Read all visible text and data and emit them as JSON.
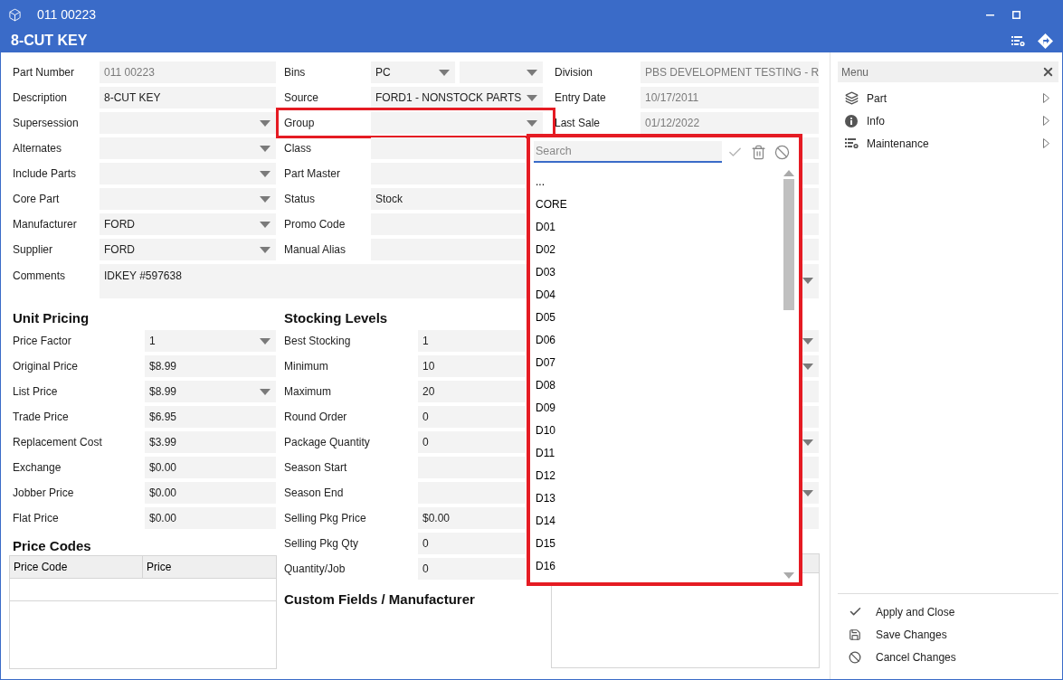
{
  "window": {
    "title": "011 00223",
    "heading": "8-CUT KEY"
  },
  "general": {
    "column_1": [
      {
        "label": "Part Number",
        "fields": [
          {
            "value": "011 00223",
            "readonly": true,
            "dropdown": false
          }
        ]
      },
      {
        "label": "Description",
        "fields": [
          {
            "value": "8-CUT KEY",
            "readonly": false,
            "dropdown": false
          }
        ]
      },
      {
        "label": "Supersession",
        "fields": [
          {
            "dropdown": true
          }
        ]
      },
      {
        "label": "Alternates",
        "fields": [
          {
            "dropdown": true
          }
        ]
      },
      {
        "label": "Include Parts",
        "fields": [
          {
            "dropdown": true
          }
        ]
      },
      {
        "label": "Core Part",
        "fields": [
          {
            "dropdown": true
          }
        ]
      },
      {
        "label": "Manufacturer",
        "fields": [
          {
            "value": "FORD",
            "readonly": false,
            "dropdown": true
          }
        ]
      },
      {
        "label": "Supplier",
        "fields": [
          {
            "value": "FORD",
            "readonly": false,
            "dropdown": true
          }
        ]
      }
    ],
    "column_2": [
      {
        "label": "Bins",
        "highlighted": false,
        "fields": [
          {
            "value": "PC",
            "readonly": false,
            "dropdown": true
          },
          {
            "dropdown": true
          }
        ]
      },
      {
        "label": "Source",
        "highlighted": false,
        "fields": [
          {
            "value": "FORD1 - NONSTOCK PARTS",
            "readonly": false,
            "dropdown": true
          }
        ]
      },
      {
        "label": "Group",
        "highlighted": true,
        "fields": [
          {
            "dropdown": true
          }
        ]
      },
      {
        "label": "Class",
        "highlighted": false,
        "fields": [
          {
            "dropdown": false
          }
        ]
      },
      {
        "label": "Part Master",
        "highlighted": false,
        "fields": [
          {
            "dropdown": false
          }
        ]
      },
      {
        "label": "Status",
        "highlighted": false,
        "fields": [
          {
            "value": "Stock",
            "readonly": false,
            "dropdown": false
          }
        ]
      },
      {
        "label": "Promo Code",
        "highlighted": false,
        "fields": [
          {
            "dropdown": false
          }
        ]
      },
      {
        "label": "Manual Alias",
        "highlighted": false,
        "fields": [
          {
            "dropdown": false
          }
        ]
      }
    ],
    "column_3": [
      {
        "label": "Division",
        "fields": [
          {
            "value": "PBS DEVELOPMENT TESTING - R",
            "readonly": true
          }
        ]
      },
      {
        "label": "Entry Date",
        "fields": [
          {
            "value": "10/17/2011",
            "readonly": true,
            "dropdown": false
          }
        ]
      },
      {
        "label": "Last Sale",
        "fields": [
          {
            "value": "01/12/2022",
            "readonly": true,
            "dropdown": false
          }
        ]
      },
      {
        "fields": [
          {
            "dropdown": false
          }
        ]
      },
      {
        "fields": [
          {
            "dropdown": false
          }
        ]
      },
      {
        "fields": [
          {
            "dropdown": false
          }
        ]
      },
      {
        "fields": [
          {
            "dropdown": false
          }
        ]
      },
      {
        "fields": [
          {
            "dropdown": false
          }
        ]
      }
    ],
    "comments": {
      "label": "Comments",
      "value": "IDKEY #597638",
      "dropdown": true
    }
  },
  "unit_pricing": {
    "title": "Unit Pricing",
    "rows": [
      {
        "label": "Price Factor",
        "value": "1",
        "dropdown": true
      },
      {
        "label": "Original Price",
        "value": "$8.99",
        "dropdown": false
      },
      {
        "label": "List Price",
        "value": "$8.99",
        "dropdown": true
      },
      {
        "label": "Trade Price",
        "value": "$6.95",
        "dropdown": false
      },
      {
        "label": "Replacement Cost",
        "value": "$3.99",
        "dropdown": false
      },
      {
        "label": "Exchange",
        "value": "$0.00",
        "dropdown": false
      },
      {
        "label": "Jobber Price",
        "value": "$0.00",
        "dropdown": false
      },
      {
        "label": "Flat Price",
        "value": "$0.00",
        "dropdown": false
      }
    ]
  },
  "price_codes": {
    "title": "Price Codes",
    "columns": [
      "Price Code",
      "Price"
    ]
  },
  "stocking_levels": {
    "title": "Stocking Levels",
    "rows": [
      {
        "label": "Best Stocking",
        "value": "1"
      },
      {
        "label": "Minimum",
        "value": "10"
      },
      {
        "label": "Maximum",
        "value": "20"
      },
      {
        "label": "Round Order",
        "value": "0"
      },
      {
        "label": "Package Quantity",
        "value": "0"
      },
      {
        "label": "Season Start"
      },
      {
        "label": "Season End"
      },
      {
        "label": "Selling Pkg Price",
        "value": "$0.00"
      },
      {
        "label": "Selling Pkg Qty",
        "value": "0"
      },
      {
        "label": "Quantity/Job",
        "value": "0"
      }
    ]
  },
  "custom_fields": {
    "title": "Custom Fields / Manufacturer"
  },
  "column_3_lower": [
    {
      "dropdown": true
    },
    {
      "dropdown": true
    },
    {
      "dropdown": false
    },
    {
      "dropdown": false
    },
    {
      "dropdown": true
    },
    {
      "dropdown": false
    },
    {
      "dropdown": true
    },
    {
      "dropdown": false
    }
  ],
  "group_dropdown": {
    "highlighted": true,
    "search": {
      "placeholder": "Search"
    },
    "items": [
      {
        "label": "...",
        "selected": false
      },
      {
        "label": "CORE",
        "selected": false
      },
      {
        "label": "D01",
        "selected": false
      },
      {
        "label": "D02",
        "selected": false
      },
      {
        "label": "D03",
        "selected": false
      },
      {
        "label": "D04",
        "selected": false
      },
      {
        "label": "D05",
        "selected": false
      },
      {
        "label": "D06",
        "selected": false
      },
      {
        "label": "D07",
        "selected": false
      },
      {
        "label": "D08",
        "selected": false
      },
      {
        "label": "D09",
        "selected": false
      },
      {
        "label": "D10",
        "selected": false
      },
      {
        "label": "D11",
        "selected": false
      },
      {
        "label": "D12",
        "selected": false
      },
      {
        "label": "D13",
        "selected": false
      },
      {
        "label": "D14",
        "selected": false
      },
      {
        "label": "D15",
        "selected": false
      },
      {
        "label": "D16",
        "selected": false
      }
    ]
  },
  "menu": {
    "title": "Menu",
    "items": [
      {
        "label": "Part"
      },
      {
        "label": "Info"
      },
      {
        "label": "Maintenance"
      }
    ],
    "actions": [
      {
        "label": "Apply and Close"
      },
      {
        "label": "Save Changes"
      },
      {
        "label": "Cancel Changes"
      }
    ]
  }
}
